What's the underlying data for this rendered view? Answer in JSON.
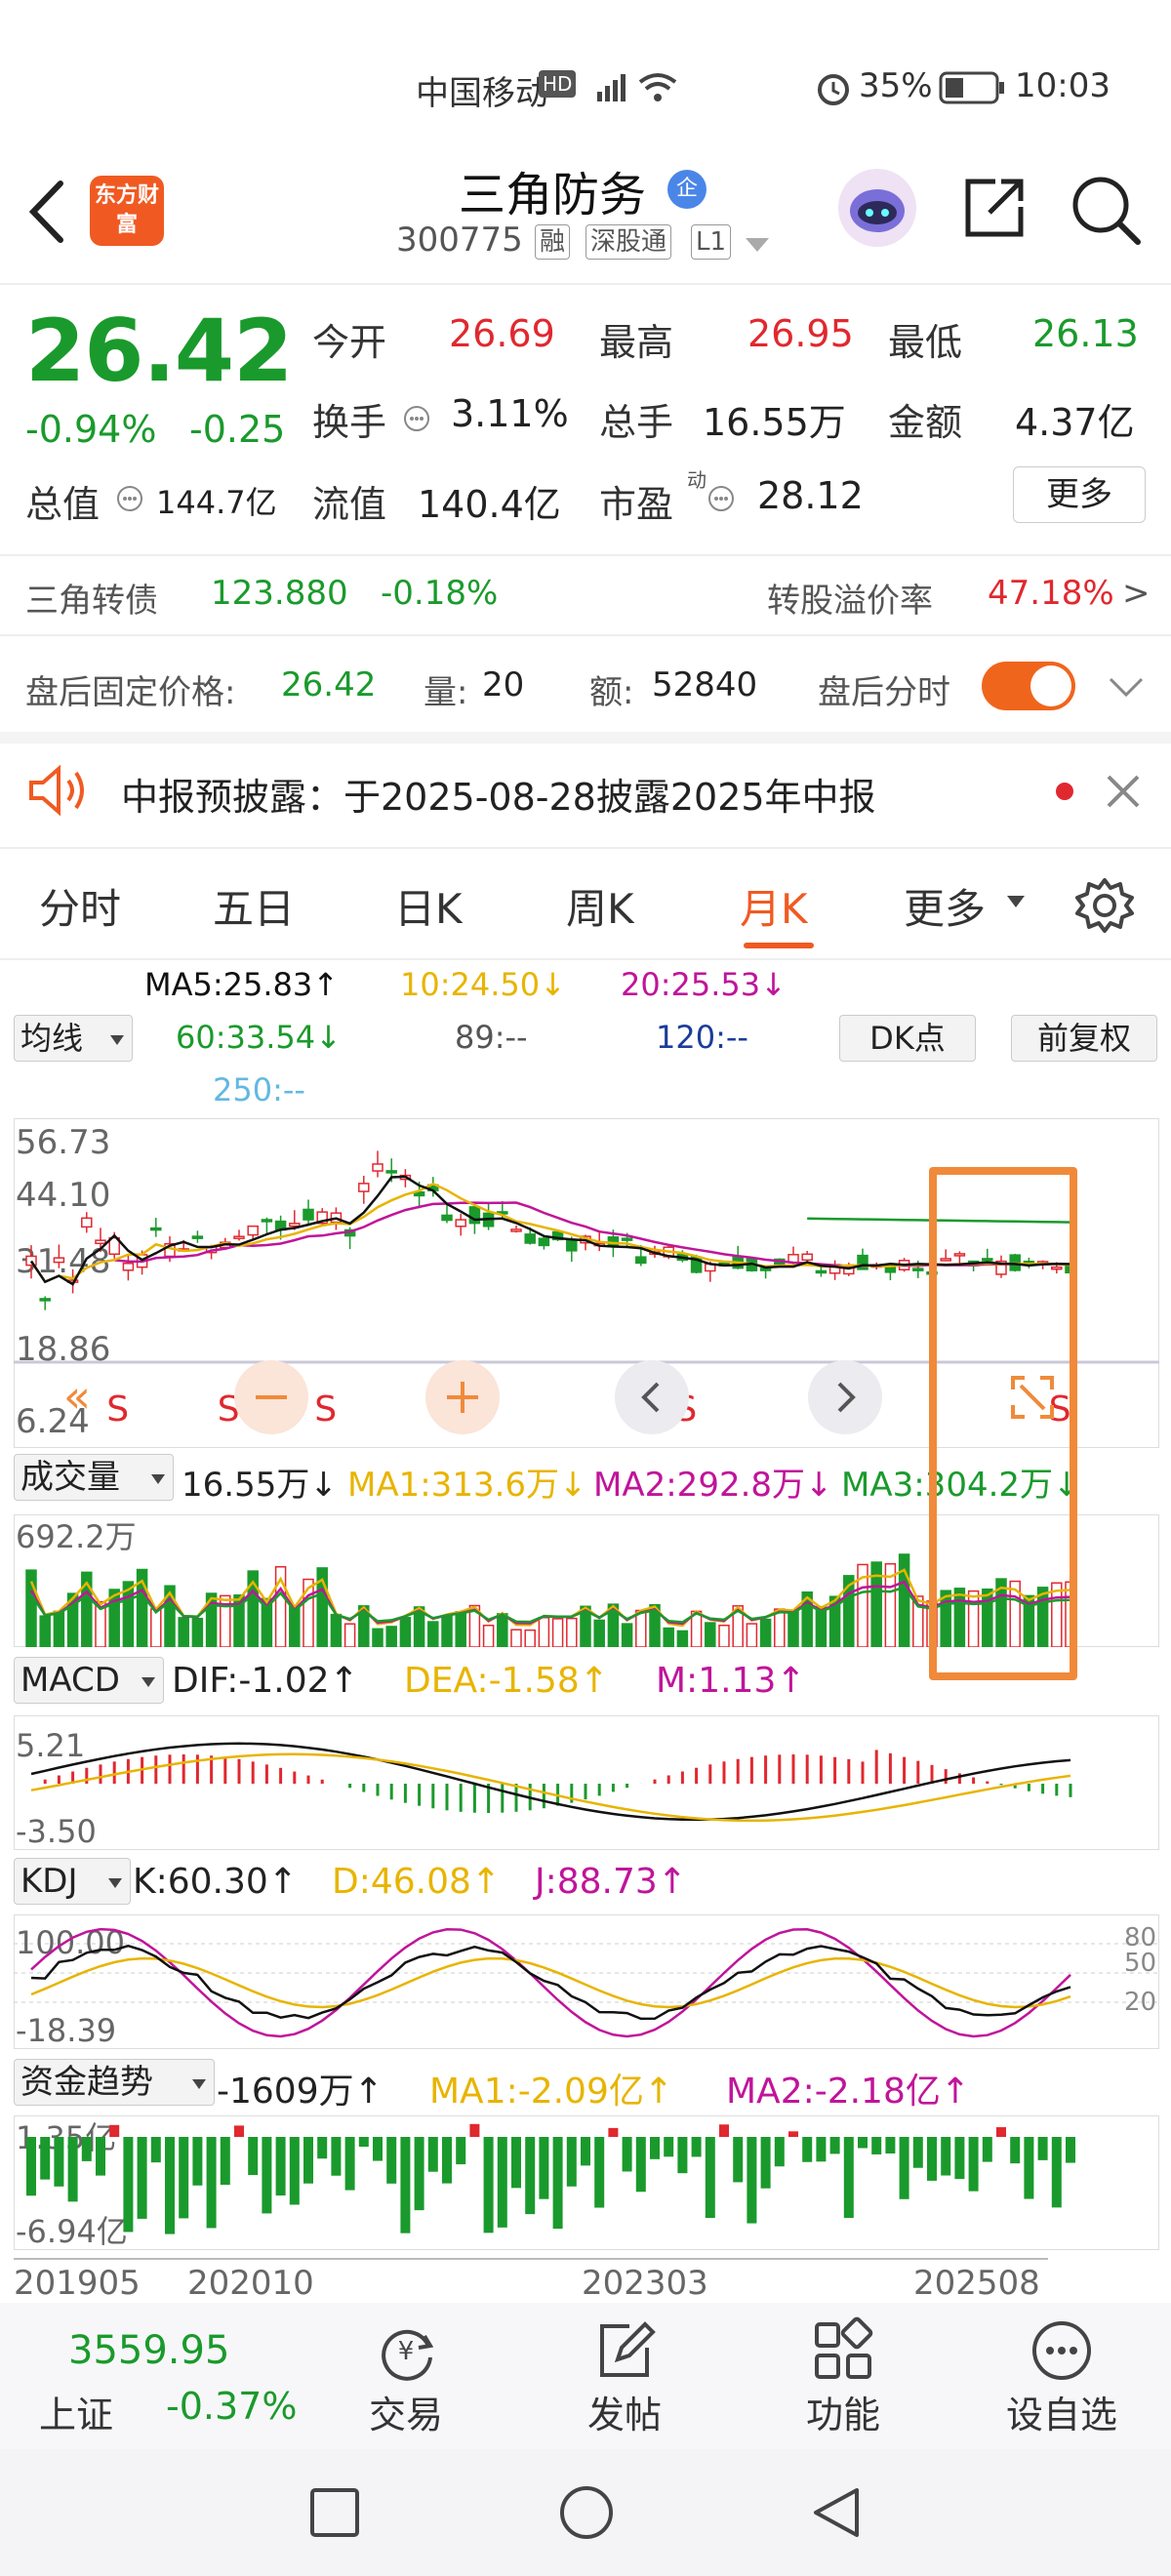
{
  "status_bar": {
    "carrier": "中国移动",
    "hd": "HD",
    "battery": "35%",
    "time": "10:03"
  },
  "header": {
    "logo_text": "东方财富",
    "stock_name": "三角防务",
    "badge": "企",
    "code": "300775",
    "tags": [
      "融",
      "深股通",
      "L1"
    ]
  },
  "quote": {
    "price": "26.42",
    "change_pct": "-0.94%",
    "change_amt": "-0.25",
    "open_label": "今开",
    "open": "26.69",
    "high_label": "最高",
    "high": "26.95",
    "low_label": "最低",
    "low": "26.13",
    "turnover_label": "换手",
    "turnover": "3.11%",
    "volume_label": "总手",
    "volume": "16.55万",
    "amount_label": "金额",
    "amount": "4.37亿",
    "mktcap_label": "总值",
    "mktcap": "144.7亿",
    "float_label": "流值",
    "float_cap": "140.4亿",
    "pe_label": "市盈",
    "pe_sup": "动",
    "pe": "28.12",
    "more_button": "更多"
  },
  "bond": {
    "name": "三角转债",
    "price": "123.880",
    "change": "-0.18%",
    "premium_label": "转股溢价率",
    "premium": "47.18%",
    "arrow": ">"
  },
  "after_hours": {
    "price_label": "盘后固定价格:",
    "price": "26.42",
    "vol_label": "量:",
    "vol": "20",
    "amt_label": "额:",
    "amt": "52840",
    "toggle_label": "盘后分时"
  },
  "notice": {
    "text": "中报预披露：于2025-08-28披露2025年中报"
  },
  "tabs": [
    "分时",
    "五日",
    "日K",
    "周K",
    "月K",
    "更多"
  ],
  "active_tab": "月K",
  "ma_legend": {
    "selector": "均线",
    "ma5": "MA5:25.83↑",
    "ma10": "10:24.50↓",
    "ma20": "20:25.53↓",
    "ma60": "60:33.54↓",
    "ma89": "89:--",
    "ma120": "120:--",
    "ma250": "250:--",
    "dk_button": "DK点",
    "adjust_button": "前复权"
  },
  "kline_axis": {
    "y1": "56.73",
    "y2": "44.10",
    "y3": "31.48",
    "y4": "18.86",
    "y5": "6.24"
  },
  "signal_marker": "S",
  "volume_panel": {
    "selector": "成交量",
    "value": "16.55万↓",
    "ma1": "MA1:313.6万↓",
    "ma2": "MA2:292.8万↓",
    "ma3": "MA3:304.2万↓",
    "axis_top": "692.2万"
  },
  "macd_panel": {
    "selector": "MACD",
    "dif": "DIF:-1.02↑",
    "dea": "DEA:-1.58↑",
    "m": "M:1.13↑",
    "axis_top": "5.21",
    "axis_bottom": "-3.50"
  },
  "kdj_panel": {
    "selector": "KDJ",
    "k": "K:60.30↑",
    "d": "D:46.08↑",
    "j": "J:88.73↑",
    "axis_top": "100.00",
    "axis_bottom": "-18.39",
    "levels": [
      "80",
      "50",
      "20"
    ]
  },
  "fund_panel": {
    "selector": "资金趋势",
    "value": "-1609万↑",
    "ma1": "MA1:-2.09亿↑",
    "ma2": "MA2:-2.18亿↑",
    "axis_top": "1.35亿",
    "axis_bottom": "-6.94亿"
  },
  "date_axis": [
    "201905",
    "202010",
    "202303",
    "202508"
  ],
  "bottom_nav": {
    "index_value": "3559.95",
    "index_name": "上证",
    "index_change": "-0.37%",
    "items": [
      "交易",
      "发帖",
      "功能",
      "设自选"
    ]
  },
  "colors": {
    "up": "#e0282f",
    "down": "#1a9a2c",
    "accent": "#f05a22",
    "ma5": "#111111",
    "ma10": "#e8b400",
    "ma20": "#c0149a",
    "ma60": "#1a9a2c",
    "highlight_box": "#f08a3a"
  }
}
